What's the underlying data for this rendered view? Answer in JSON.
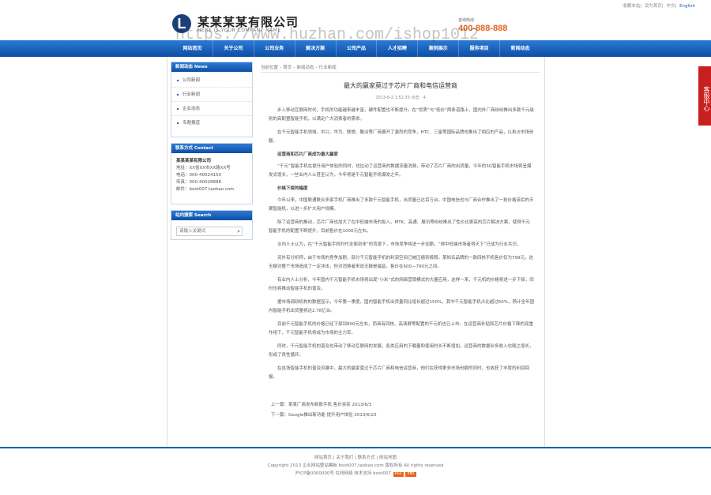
{
  "top_links": {
    "favorite": "收藏本站",
    "home": "设为首页",
    "cn": "中文",
    "en": "English"
  },
  "header": {
    "logo_letter": "L",
    "company_name": "某某某某有限公司",
    "company_en": "HERE IS YOUR COMPANY NAME",
    "hotline_label": "咨询热线",
    "hotline": "400-888-888",
    "watermark": "https://www.huzhan.com/ishop1012"
  },
  "nav": [
    "网站首页",
    "关于公司",
    "公司业务",
    "解决方案",
    "公司产品",
    "人才招聘",
    "案例展示",
    "服务项目",
    "新闻动态"
  ],
  "sidebar": {
    "news_title": "新闻动态 News",
    "news_items": [
      "公司新闻",
      "行业新闻",
      "企业动态",
      "专题报道"
    ],
    "contact_title": "联系方式 Contact",
    "contact_name": "某某某某有限公司",
    "contact_address": "地址：XX省XX市XX路XX号",
    "contact_phone": "电话：000-40024150",
    "contact_fax": "传真：000-40028888",
    "contact_email": "邮件：boot007.taobao.com",
    "search_title": "站内搜索 Search",
    "search_placeholder": "请输入关键词"
  },
  "breadcrumb": [
    "当前位置",
    "首页",
    "新闻动态",
    "行业新闻"
  ],
  "article": {
    "title": "最大的赢家莫过于芯片厂商和电信运营商",
    "meta": "2013-6-2 1:52:33  点击：4",
    "paragraphs": [
      "步入移动互联网时代，手机的功能越来越丰富，硬件配置也不断提升。在“优质”与“低价”两条道路上，国内外厂商纷纷推出多款千元级别的高配置智能手机，以满足广大消费者的需求。",
      "在千元智能手机领域，中兴、华为、联想、酷派等厂商展开了激烈的竞争，HTC、三星等国际品牌也推出了相应的产品，以抢占市场份额。",
      "运营商和芯片厂商成为最大赢家",
      "“千元”智能手机在提升用户体验的同时，也拉动了运营商的数据流量消费，带动了芯片厂商的出货量，今年的3G智能手机市场将呈爆发式增长，一些业内人士甚至认为，今年将是千元智能手机爆发之年。",
      "价格下探的幅度",
      "今年以来，中国联通联合多家手机厂商推出了多款千元智能手机，出货量已达百万台。中国电信也与厂商合作推出了一批价格亲民的天翼智能机，以进一步扩大用户规模。",
      "除了运营商的推动，芯片厂商也加大了在中低端市场的投入。MTK、高通、展讯等纷纷推出了性价比更高的芯片解决方案，使得千元智能手机的配置不断提升，目前售价在1000元左右。",
      "业内人士认为，在“千元智能手机时代全面到来”的背景下，市场竞争将进一步加剧，“得中低端市场者得天下”已成为行业共识。",
      "另外有分析称，由于市场的竞争加剧，部分千元智能手机的利润空间已被压缩到极限。某知名品牌的一款四核手机售价仅为799元，这无疑对整个市场造成了一定冲击，但对消费者来说无疑是福音，售价在600—790元之间。",
      "有业内人士分析，今年国内千元智能手机市场将出现“小米”式的网络营销模式的大量应用，这样一来，千元机的价格将进一步下探，同时也将推动智能手机的普及。",
      "据市场调研机构的数据显示，今年第一季度，国内智能手机出货量同比增长超过150%，其中千元智能手机占比超过60%，预计全年国内智能手机出货量将达2.78亿台。",
      "目前千元智能手机的价格已经下探到800元左右，而具有四核、高清屏等配置的千元机也已上市。在运营商补贴和芯片价格下降的双重作用下，千元智能手机将成为市场的主力军。",
      "同时，千元智能手机的普及也带动了移动互联网的发展，各类应用的下载量和使用时长不断增加，运营商的数据业务收入也随之增长，形成了良性循环。",
      "在这场智能手机的普及风暴中，最大的赢家莫过于芯片厂商和电信运营商，他们在获得更多市场份额的同时，也收获了丰厚的利润回报。"
    ],
    "strong_indexes": [
      2,
      4
    ],
    "prev": "上一篇：某某厂商发布新款手机 售价亲民 2013/6/3",
    "next": "下一篇：Google推出新功能 提升用户体验 2013/6/23"
  },
  "footer": {
    "links": "网站首页 | 关于我们 | 联系方式 | 网站地图",
    "copyright": "Copyright 2013 企业网站整站模板 boot007.taobao.com 版权所有 All rights reserved",
    "icp": "沪ICP备0000000号  在线网络 技术支持 boot007",
    "badge1": "RSS",
    "badge2": "XML"
  },
  "float_service": "客服中心"
}
